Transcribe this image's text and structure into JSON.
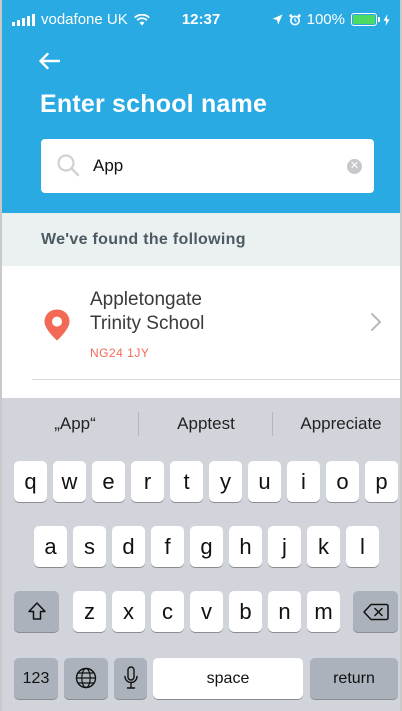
{
  "status_bar": {
    "carrier": "vodafone UK",
    "time": "12:37",
    "battery": "100%"
  },
  "header": {
    "title": "Enter school name"
  },
  "search": {
    "value": "App",
    "placeholder": ""
  },
  "results": {
    "heading": "We've found the following",
    "items": [
      {
        "name": "Appletongate\nTrinity School",
        "postcode": "NG24 1JY"
      }
    ]
  },
  "keyboard": {
    "suggestions": [
      "„App“",
      "Apptest",
      "Appreciate"
    ],
    "row1": [
      "q",
      "w",
      "e",
      "r",
      "t",
      "y",
      "u",
      "i",
      "o",
      "p"
    ],
    "row2": [
      "a",
      "s",
      "d",
      "f",
      "g",
      "h",
      "j",
      "k",
      "l"
    ],
    "row3": [
      "z",
      "x",
      "c",
      "v",
      "b",
      "n",
      "m"
    ],
    "numbers_label": "123",
    "space_label": "space",
    "return_label": "return"
  },
  "colors": {
    "header_blue": "#29aae2",
    "accent_coral": "#f26a55",
    "battery_green": "#4cd964"
  }
}
